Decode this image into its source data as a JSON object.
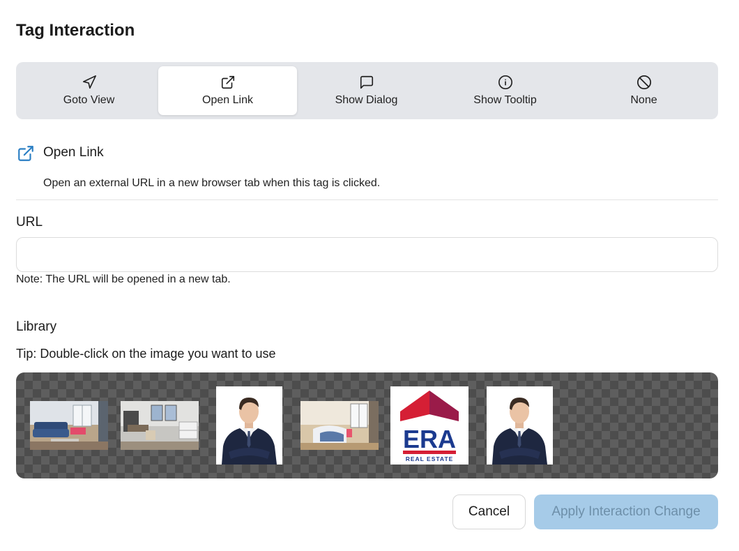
{
  "dialog": {
    "title": "Tag Interaction"
  },
  "tabs": [
    {
      "label": "Goto View",
      "icon": "navigation-arrow-icon",
      "active": false
    },
    {
      "label": "Open Link",
      "icon": "external-link-icon",
      "active": true
    },
    {
      "label": "Show Dialog",
      "icon": "message-square-icon",
      "active": false
    },
    {
      "label": "Show Tooltip",
      "icon": "info-circle-icon",
      "active": false
    },
    {
      "label": "None",
      "icon": "ban-icon",
      "active": false
    }
  ],
  "section": {
    "icon": "external-link-icon",
    "title": "Open Link",
    "description": "Open an external URL in a new browser tab when this tag is clicked."
  },
  "url": {
    "label": "URL",
    "value": "",
    "placeholder": "",
    "note": "Note: The URL will be opened in a new tab."
  },
  "library": {
    "label": "Library",
    "tip": "Tip: Double-click on the image you want to use",
    "images": [
      {
        "kind": "living-room-photo"
      },
      {
        "kind": "office-room-photo"
      },
      {
        "kind": "agent-portrait"
      },
      {
        "kind": "bedroom-photo"
      },
      {
        "kind": "era-logo",
        "logo_text": "ERA",
        "logo_subtext": "REAL ESTATE"
      },
      {
        "kind": "agent-portrait"
      }
    ]
  },
  "footer": {
    "cancel_label": "Cancel",
    "apply_label": "Apply Interaction Change",
    "apply_enabled": false
  },
  "colors": {
    "accent": "#2b7fc4",
    "apply_disabled_bg": "#a6cbe8",
    "apply_disabled_text": "#6d8fa9",
    "era_red": "#d51f35",
    "era_blue": "#1b3a8f"
  }
}
